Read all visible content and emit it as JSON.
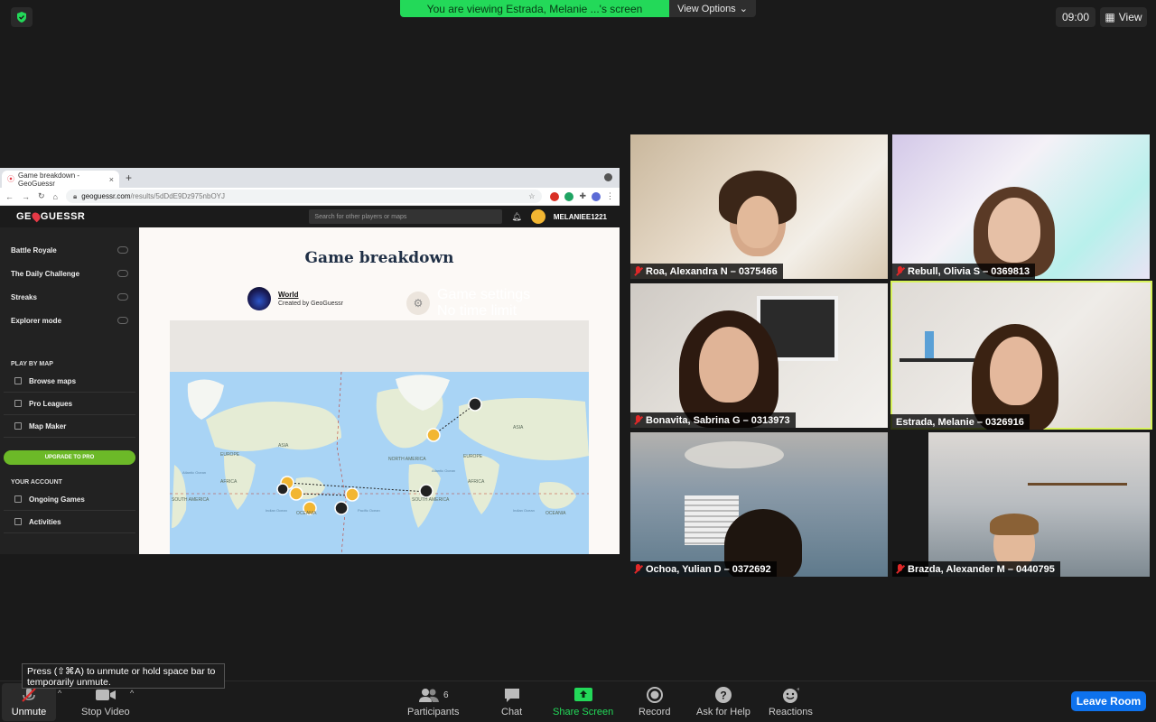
{
  "top": {
    "banner_text": "You are viewing Estrada, Melanie ...'s screen",
    "view_options_label": "View Options",
    "clock": "09:00",
    "view_label": "View"
  },
  "browser": {
    "tab_title": "Game breakdown - GeoGuessr",
    "url_host": "geoguessr.com",
    "url_path": "/results/5dDdE9Dz975nbOYJ"
  },
  "geoguessr": {
    "logo_left": "GE",
    "logo_right": "GUESSR",
    "search_placeholder": "Search for other players or maps",
    "username": "MELANIEE1221",
    "modes": [
      {
        "label": "Battle Royale"
      },
      {
        "label": "The Daily Challenge"
      },
      {
        "label": "Streaks"
      },
      {
        "label": "Explorer mode"
      }
    ],
    "play_by_map_heading": "PLAY BY MAP",
    "play_links": [
      {
        "label": "Browse maps"
      },
      {
        "label": "Pro Leagues"
      },
      {
        "label": "Map Maker"
      }
    ],
    "upgrade_label": "UPGRADE TO PRO",
    "account_heading": "YOUR ACCOUNT",
    "account_links": [
      {
        "label": "Ongoing Games"
      },
      {
        "label": "Activities"
      }
    ],
    "page_title": "Game breakdown",
    "map_name": "World",
    "map_creator": "Created by GeoGuessr",
    "settings_title": "Game settings",
    "settings_value": "No time limit",
    "map_labels": {
      "asia": "ASIA",
      "europe": "EUROPE",
      "africa": "AFRICA",
      "north_america": "NORTH AMERICA",
      "south_america": "SOUTH AMERICA",
      "oceania": "OCEANIA",
      "europe2": "EUROPE",
      "africa2": "AFRICA",
      "asia2": "ASIA",
      "south_america2": "SOUTH AMERICA",
      "atlantic": "Atlantic Ocean",
      "indian": "Indian Ocean",
      "pacific": "Pacific Ocean",
      "atlantic2": "Atlantic Ocean",
      "indian2": "Indian Ocean",
      "oceania2": "OCEANIA"
    }
  },
  "participants": [
    {
      "name": "Roa, Alexandra N – 0375466"
    },
    {
      "name": "Rebull, Olivia S – 0369813"
    },
    {
      "name": "Bonavita, Sabrina G – 0313973"
    },
    {
      "name": "Estrada, Melanie – 0326916"
    },
    {
      "name": "Ochoa, Yulian D – 0372692"
    },
    {
      "name": "Brazda, Alexander M – 0440795"
    }
  ],
  "tooltip": "Press  (⇧⌘A) to unmute or hold space bar to temporarily unmute.",
  "toolbar": {
    "unmute": "Unmute",
    "stop_video": "Stop Video",
    "participants": "Participants",
    "participants_count": "6",
    "chat": "Chat",
    "share_screen": "Share Screen",
    "record": "Record",
    "ask_for_help": "Ask for Help",
    "reactions": "Reactions",
    "leave_room": "Leave Room"
  },
  "colors": {
    "banner_green": "#23d959",
    "leave_blue": "#0e72ed",
    "active_speaker": "#d7f35a",
    "muted_red": "#e02828"
  }
}
